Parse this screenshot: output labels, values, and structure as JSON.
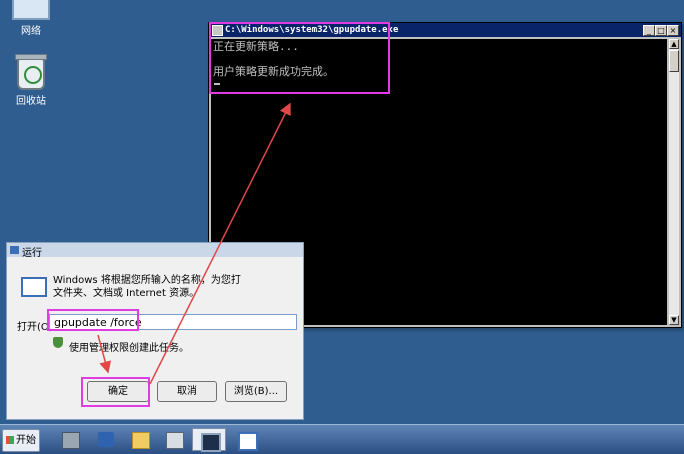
{
  "desktop": {
    "icons": [
      {
        "label": "网络"
      },
      {
        "label": "回收站"
      }
    ]
  },
  "console": {
    "title": "C:\\Windows\\system32\\gpupdate.exe",
    "lines": [
      "正在更新策略...",
      "用户策略更新成功完成。"
    ],
    "controls": {
      "minimize": "_",
      "maximize": "□",
      "close": "×"
    }
  },
  "run_dialog": {
    "title": "运行",
    "description_line1": "Windows 将根据您所输入的名称，为您打",
    "description_line2": "文件夹、文档或 Internet 资源。",
    "open_label": "打开(O):",
    "input_value": "gpupdate /force",
    "admin_note": "使用管理权限创建此任务。",
    "ok_label": "确定",
    "cancel_label": "取消",
    "browse_label": "浏览(B)..."
  },
  "taskbar": {
    "start_label": "开始",
    "items": [
      "server-manager",
      "powershell",
      "explorer",
      "notes",
      "command-prompt",
      "run"
    ]
  },
  "colors": {
    "desktop": "#2f5d8f",
    "highlight": "#e13be3",
    "arrow": "#e04848",
    "console_bg": "#000000",
    "console_title": "#0a246a"
  }
}
